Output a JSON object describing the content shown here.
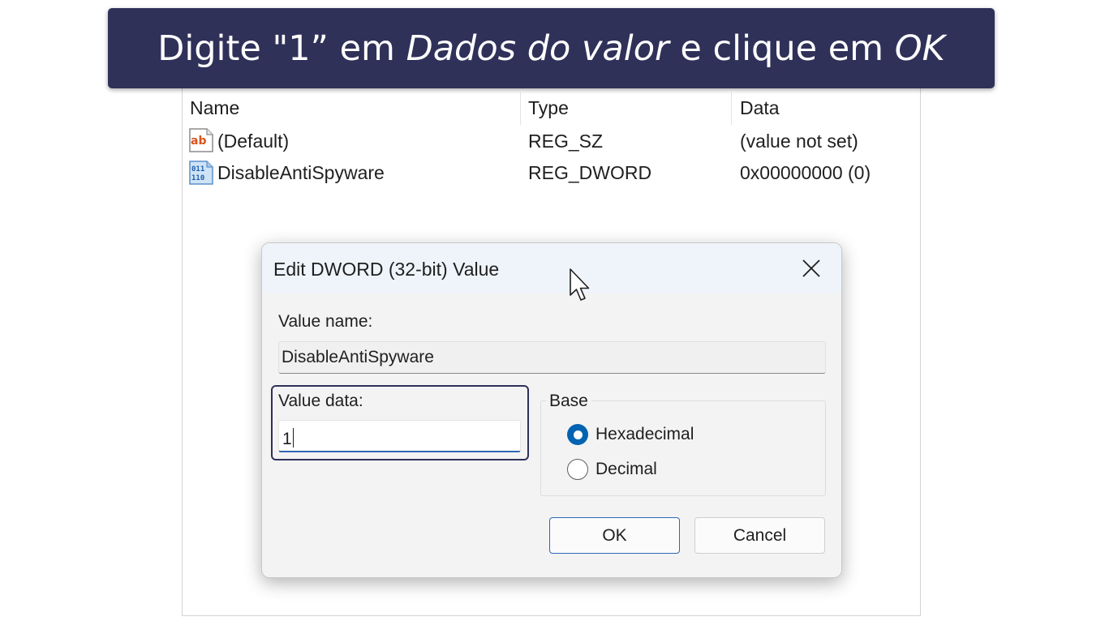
{
  "banner": {
    "part1": "Digite \"1” em ",
    "part2": "Dados do valor",
    "part3": " e clique em ",
    "part4": "OK"
  },
  "list": {
    "columns": [
      "Name",
      "Type",
      "Data"
    ],
    "rows": [
      {
        "icon": "string-value-icon",
        "name": "(Default)",
        "type": "REG_SZ",
        "data": "(value not set)"
      },
      {
        "icon": "binary-value-icon",
        "name": "DisableAntiSpyware",
        "type": "REG_DWORD",
        "data": "0x00000000 (0)"
      }
    ]
  },
  "dialog": {
    "title": "Edit DWORD (32-bit) Value",
    "value_name_label": "Value name:",
    "value_name": "DisableAntiSpyware",
    "value_data_label": "Value data:",
    "value_data": "1",
    "base_label": "Base",
    "base_options": [
      {
        "label": "Hexadecimal",
        "selected": true
      },
      {
        "label": "Decimal",
        "selected": false
      }
    ],
    "ok_label": "OK",
    "cancel_label": "Cancel"
  },
  "colors": {
    "banner_bg": "#2f3159",
    "accent": "#0063b1",
    "highlight_border": "#2f3159"
  },
  "icons": {
    "close": "close-icon",
    "cursor": "mouse-pointer-icon"
  }
}
